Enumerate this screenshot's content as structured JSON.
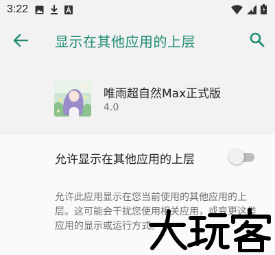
{
  "status_bar": {
    "time": "3:22",
    "icons_left": [
      "image-icon",
      "download-icon",
      "a-box-icon"
    ],
    "icons_right": [
      "wifi-icon",
      "signal-icon",
      "battery-icon"
    ]
  },
  "app_bar": {
    "title": "显示在其他应用的上层",
    "accent_color": "#1e8b73"
  },
  "app": {
    "name": "唯雨超自然Max正式版",
    "version": "4.0"
  },
  "setting": {
    "label": "允许显示在其他应用的上层",
    "enabled": false,
    "description": "允许此应用显示在您当前使用的其他应用的上层。这可能会干扰您使用相关应用，或变更这类应用的显示或运行方式。"
  },
  "watermark": {
    "text": "大玩客"
  }
}
